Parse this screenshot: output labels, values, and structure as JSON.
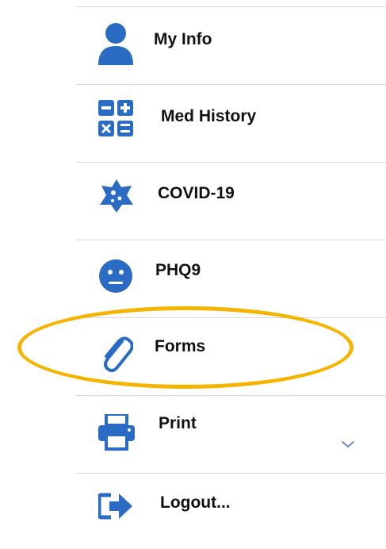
{
  "colors": {
    "icon": "#2a6cc4",
    "highlight": "#f5b400",
    "divider": "#d8d8d8"
  },
  "menu": {
    "items": [
      {
        "label": "My Info",
        "icon": "user-icon"
      },
      {
        "label": "Med History",
        "icon": "calculator-icon"
      },
      {
        "label": "COVID-19",
        "icon": "virus-icon"
      },
      {
        "label": "PHQ9",
        "icon": "neutral-face-icon"
      },
      {
        "label": "Forms",
        "icon": "paperclip-icon"
      },
      {
        "label": "Print",
        "icon": "printer-icon"
      },
      {
        "label": "Logout...",
        "icon": "sign-out-icon"
      }
    ]
  },
  "highlighted_item": "Forms"
}
